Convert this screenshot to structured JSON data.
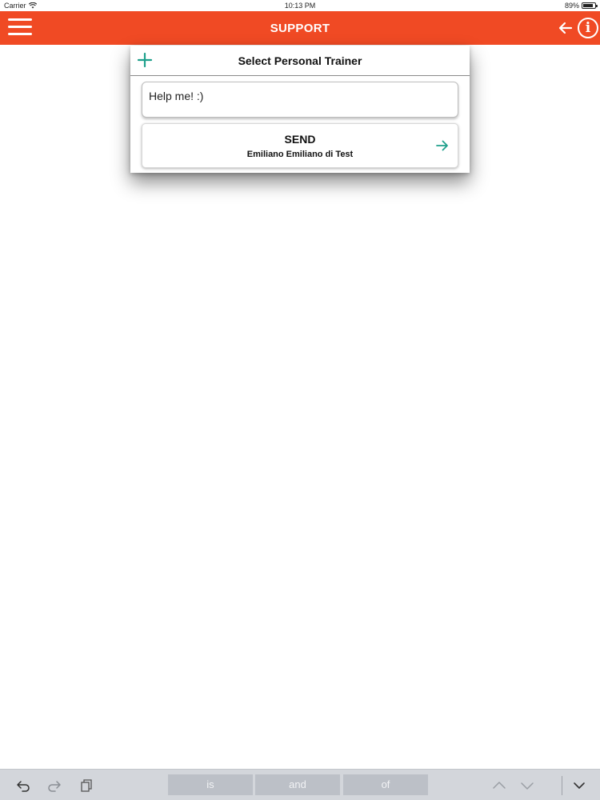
{
  "status_bar": {
    "carrier": "Carrier",
    "time": "10:13 PM",
    "battery": "89%",
    "battery_level": 0.89
  },
  "nav": {
    "title": "SUPPORT"
  },
  "card": {
    "title": "Select Personal Trainer",
    "message_value": "Help me! :)",
    "send_label": "SEND",
    "recipient": "Emiliano Emiliano di Test"
  },
  "keyboard": {
    "suggestions": [
      "is",
      "and",
      "of"
    ]
  },
  "colors": {
    "accent": "#f04a24",
    "teal": "#1fa08c"
  }
}
